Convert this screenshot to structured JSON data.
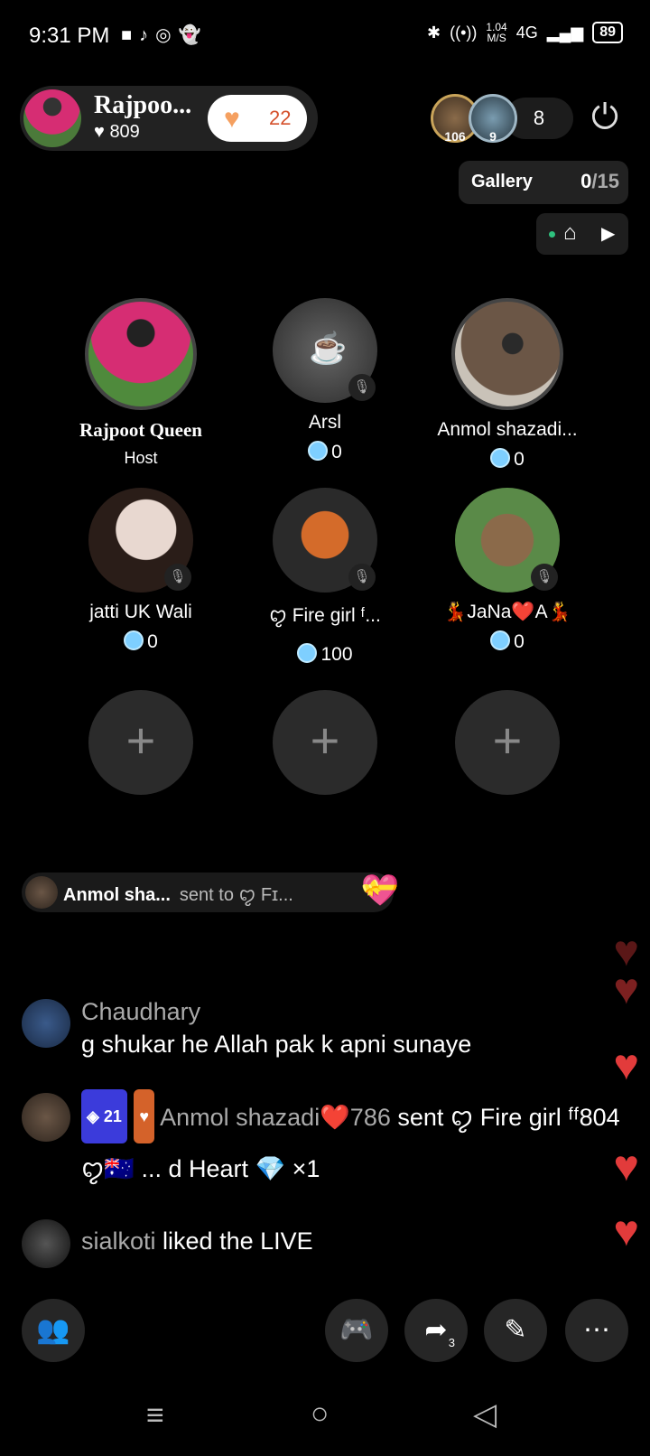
{
  "status_bar": {
    "time": "9:31 PM",
    "network_speed": "1.04",
    "network_unit": "M/S",
    "network_type": "4G",
    "battery": "89"
  },
  "host": {
    "name": "Rajpoo...",
    "likes": "809",
    "like_badge_count": "22"
  },
  "viewers": {
    "avatar1_level": "106",
    "avatar2_level": "9",
    "count": "8"
  },
  "gallery": {
    "label": "Gallery",
    "count_current": "0",
    "count_total": "/15"
  },
  "seats": [
    {
      "name": "Rajpoot Queen",
      "sub": "Host",
      "is_host": true
    },
    {
      "name": "Arsl",
      "score": "0"
    },
    {
      "name": "Anmol shazadi...",
      "score": "0"
    },
    {
      "name": "jatti UK Wali",
      "score": "0"
    },
    {
      "name": "ꨄ Fire girl ᶠ...",
      "score": "100"
    },
    {
      "name": "💃JaNa❤️A💃",
      "score": "0"
    }
  ],
  "empty_seat_label": "+",
  "gift_banner": {
    "sender": "Anmol sha...",
    "text": "sent to ꨄ Fɪ..."
  },
  "chat": [
    {
      "user": "Chaudhary",
      "text": "g shukar he Allah pak k apni sunaye"
    },
    {
      "badge1": "21",
      "user": "Anmol shazadi❤️786",
      "text": "sent ꨄ Fire girl ᶠᶠ804 ꨄ🇦🇺 ... d Heart 💎 ×1"
    },
    {
      "user": "sialkoti",
      "text": "liked the LIVE"
    }
  ],
  "bottom_bar": {
    "share_count": "3"
  },
  "colors": {
    "background": "#000000",
    "like_badge": "#f5a060",
    "heart": "#e23b3b",
    "gem": "#7ecfff"
  }
}
